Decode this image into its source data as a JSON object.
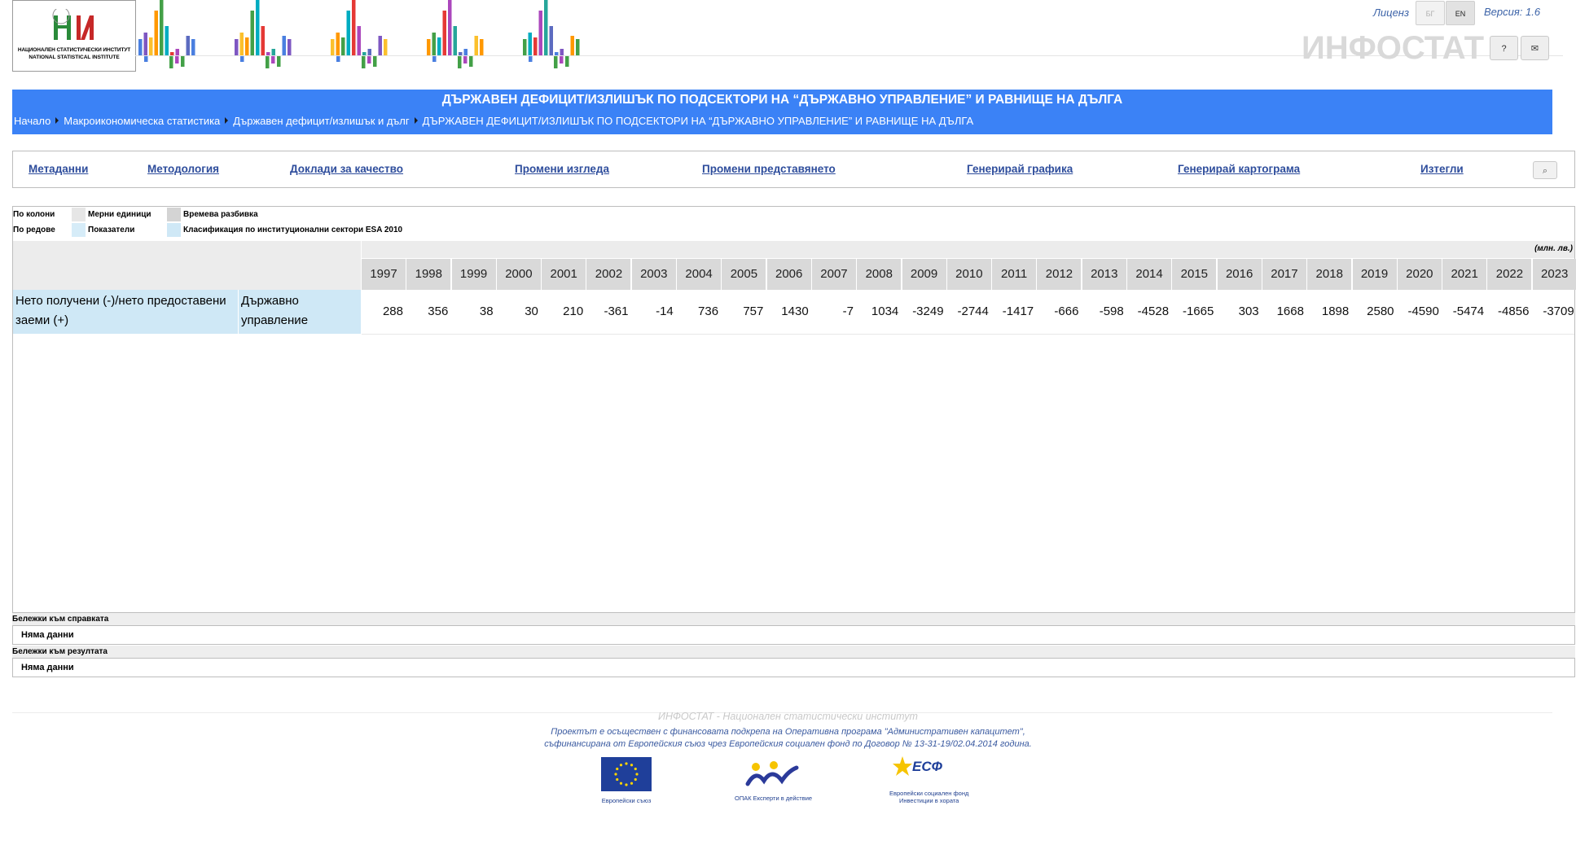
{
  "header": {
    "logo_line1": "НАЦИОНАЛЕН СТАТИСТИЧЕСКИ ИНСТИТУТ",
    "logo_line2": "NATIONAL STATISTICAL INSTITUTE",
    "license_label": "Лиценз",
    "lang_bg": "БГ",
    "lang_en": "EN",
    "version": "Версия: 1.6",
    "brand": "ИНФОСТАТ",
    "help_label": "?",
    "mail_icon": "mail-icon"
  },
  "banner": {
    "title": "ДЪРЖАВЕН ДЕФИЦИТ/ИЗЛИШЪК ПО ПОДСЕКТОРИ НА “ДЪРЖАВНО УПРАВЛЕНИЕ” И РАВНИЩЕ НА ДЪЛГА",
    "breadcrumbs": [
      "Начало",
      "Макроикономическа статистика",
      "Държавен дефицит/излишък и дълг",
      "ДЪРЖАВЕН ДЕФИЦИТ/ИЗЛИШЪК ПО ПОДСЕКТОРИ НА “ДЪРЖАВНО УПРАВЛЕНИЕ” И РАВНИЩЕ НА ДЪЛГА"
    ]
  },
  "toolbar": {
    "metadata": "Метаданни",
    "methodology": "Методология",
    "quality_reports": "Доклади за качество",
    "change_view": "Промени изгледа",
    "change_presentation": "Промени представянето",
    "generate_chart": "Генерирай графика",
    "generate_map": "Генерирай картограма",
    "download": "Изтегли",
    "search_icon": "search-icon"
  },
  "table": {
    "by_columns_label": "По колони",
    "by_rows_label": "По редове",
    "col_dim1": "Мерни единици",
    "col_dim2": "Времева разбивка",
    "row_dim1": "Показатели",
    "row_dim2": "Класификация по институционални сектори ESA 2010",
    "unit": "(млн. лв.)",
    "years": [
      "1997",
      "1998",
      "1999",
      "2000",
      "2001",
      "2002",
      "2003",
      "2004",
      "2005",
      "2006",
      "2007",
      "2008",
      "2009",
      "2010",
      "2011",
      "2012",
      "2013",
      "2014",
      "2015",
      "2016",
      "2017",
      "2018",
      "2019",
      "2020",
      "2021",
      "2022",
      "2023"
    ],
    "row_indicator": "Нето получени (-)/нето предоставени заеми (+)",
    "row_sector": "Държавно управление",
    "values": [
      "288",
      "356",
      "38",
      "30",
      "210",
      "-361",
      "-14",
      "736",
      "757",
      "1430",
      "-7",
      "1034",
      "-3249",
      "-2744",
      "-1417",
      "-666",
      "-598",
      "-4528",
      "-1665",
      "303",
      "1668",
      "1898",
      "2580",
      "-4590",
      "-5474",
      "-4856",
      "-3709"
    ]
  },
  "notes": {
    "report_label": "Бележки към справката",
    "report_text": "Няма данни",
    "result_label": "Бележки към резултата",
    "result_text": "Няма данни"
  },
  "footer": {
    "line1": "ИНФОСТАТ - Национален статистически институт",
    "line2": "Проектът е осъществен с финансовата подкрепа на Оперативна програма \"Административен капацитет\",",
    "line3": "съфинансирана от Европейския съюз чрез Европейския социален фонд по Договор № 13-31-19/02.04.2014 година.",
    "eu_caption": "Европейски съюз",
    "opak_caption": "ОПАК Експерти в действие",
    "esf_name": "ЕСФ",
    "esf_caption1": "Европейски социален фонд",
    "esf_caption2": "Инвестиции в хората"
  },
  "colors": {
    "banner": "#3b82f6",
    "link": "#2e4d9c",
    "row_header": "#cfe8f6",
    "year_header": "#d9d9d9"
  }
}
